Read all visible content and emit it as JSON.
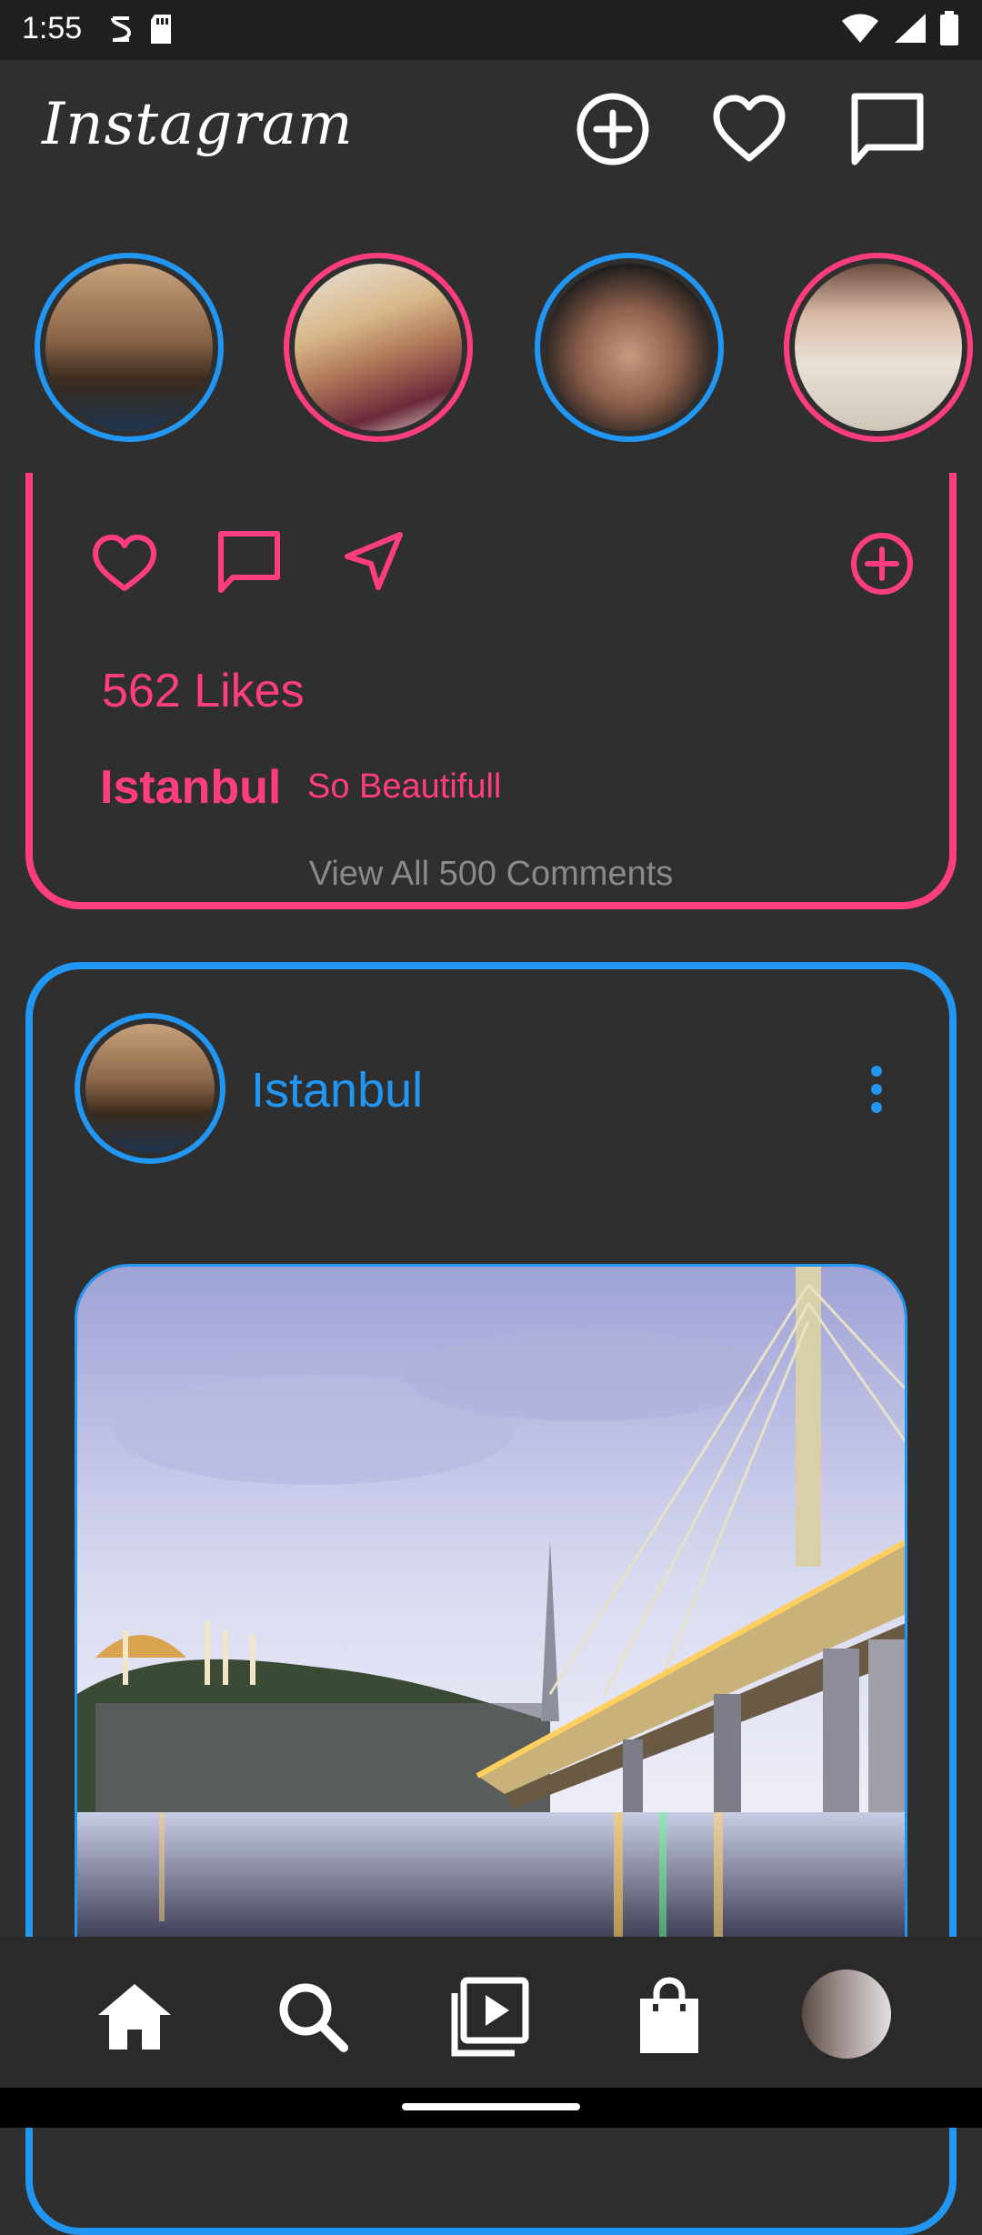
{
  "status_bar": {
    "time": "1:55",
    "left_icons": [
      "accessibility-icon",
      "sd-card-icon"
    ],
    "right_icons": [
      "wifi-icon",
      "signal-icon",
      "battery-icon"
    ]
  },
  "header": {
    "logo": "Instagram",
    "actions": [
      "add-post-icon",
      "heart-icon",
      "message-icon"
    ]
  },
  "stories": [
    {
      "name": "story-1",
      "ring": "#2196f3"
    },
    {
      "name": "story-2",
      "ring": "#ff3d7f"
    },
    {
      "name": "story-3",
      "ring": "#2196f3"
    },
    {
      "name": "story-4",
      "ring": "#ff3d7f"
    }
  ],
  "post1": {
    "accent": "#ff3d7f",
    "likes": "562  Likes",
    "caption_user": "Istanbul",
    "caption_text": "So Beautifull",
    "view_comments": "View All 500 Comments"
  },
  "post2": {
    "accent": "#2196f3",
    "username": "Istanbul"
  },
  "bottom_nav": [
    "home-icon",
    "search-icon",
    "reels-icon",
    "shop-icon",
    "profile-avatar"
  ],
  "colors": {
    "background": "#2f2f2f",
    "pink": "#ff3d7f",
    "blue": "#2196f3"
  }
}
